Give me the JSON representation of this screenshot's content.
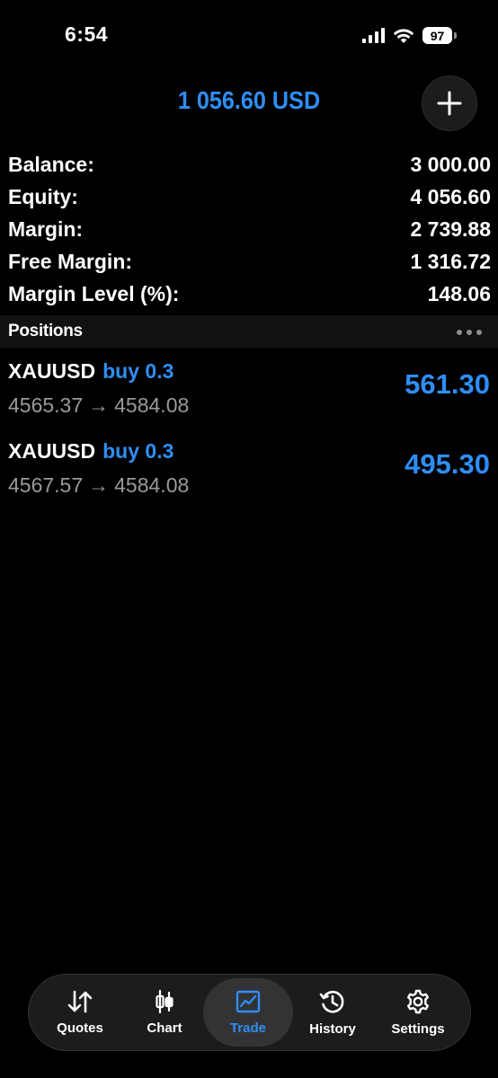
{
  "status_bar": {
    "time": "6:54",
    "battery": "97",
    "icons": [
      "cellular-signal-icon",
      "wifi-icon",
      "battery-icon"
    ]
  },
  "header": {
    "total": "1 056.60 USD",
    "add_icon": "plus-icon"
  },
  "account": [
    {
      "label": "Balance:",
      "value": "3 000.00"
    },
    {
      "label": "Equity:",
      "value": "4 056.60"
    },
    {
      "label": "Margin:",
      "value": "2 739.88"
    },
    {
      "label": "Free Margin:",
      "value": "1 316.72"
    },
    {
      "label": "Margin Level (%):",
      "value": "148.06"
    }
  ],
  "positions": {
    "title": "Positions",
    "menu_icon": "more-icon",
    "items": [
      {
        "symbol": "XAUUSD",
        "side": "buy 0.3",
        "open_price": "4565.37",
        "arrow": "→",
        "current_price": "4584.08",
        "profit": "561.30"
      },
      {
        "symbol": "XAUUSD",
        "side": "buy 0.3",
        "open_price": "4567.57",
        "arrow": "→",
        "current_price": "4584.08",
        "profit": "495.30"
      }
    ]
  },
  "tabs": [
    {
      "label": "Quotes",
      "icon": "quotes-arrows-icon",
      "active": false
    },
    {
      "label": "Chart",
      "icon": "candlestick-icon",
      "active": false
    },
    {
      "label": "Trade",
      "icon": "trade-chart-icon",
      "active": true
    },
    {
      "label": "History",
      "icon": "history-clock-icon",
      "active": false
    },
    {
      "label": "Settings",
      "icon": "gear-icon",
      "active": false
    }
  ],
  "colors": {
    "accent": "#2f8ef5",
    "background": "#000000",
    "secondary_text": "#9a9a9e"
  }
}
